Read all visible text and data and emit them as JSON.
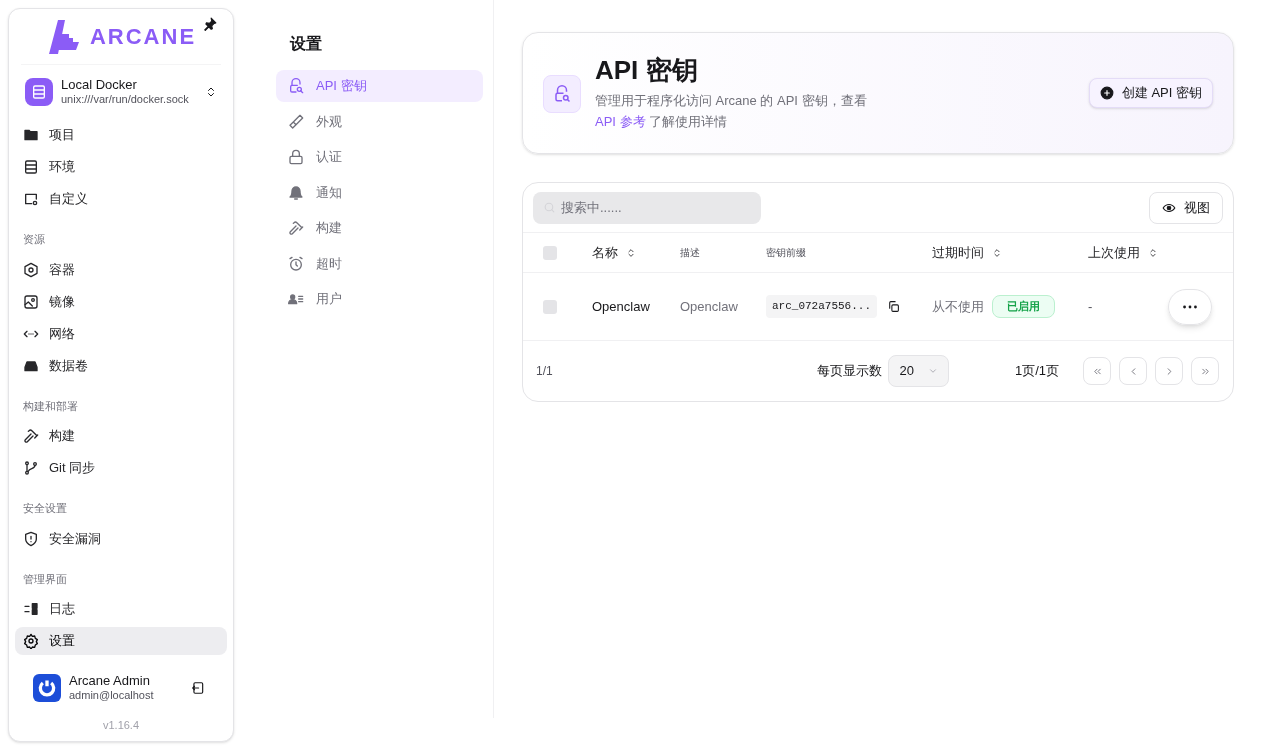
{
  "sidebar": {
    "logo": "ARCANE",
    "environment": {
      "name": "Local Docker",
      "address": "unix:///var/run/docker.sock"
    },
    "sections": [
      {
        "items": [
          {
            "label": "项目",
            "selected": false
          },
          {
            "label": "环境",
            "selected": false
          },
          {
            "label": "自定义",
            "selected": false
          }
        ]
      },
      {
        "heading": "资源",
        "items": [
          {
            "label": "容器",
            "selected": false
          },
          {
            "label": "镜像",
            "selected": false
          },
          {
            "label": "网络",
            "selected": false
          },
          {
            "label": "数据卷",
            "selected": false
          }
        ]
      },
      {
        "heading": "构建和部署",
        "items": [
          {
            "label": "构建",
            "selected": false
          },
          {
            "label": "Git 同步",
            "selected": false
          }
        ]
      },
      {
        "heading": "安全设置",
        "items": [
          {
            "label": "安全漏洞",
            "selected": false
          }
        ]
      },
      {
        "heading": "管理界面",
        "items": [
          {
            "label": "日志",
            "selected": false
          },
          {
            "label": "设置",
            "selected": true
          }
        ]
      }
    ],
    "user": {
      "name": "Arcane Admin",
      "email": "admin@localhost"
    },
    "version": "v1.16.4"
  },
  "settings_nav": {
    "title": "设置",
    "items": [
      {
        "label": "API 密钥",
        "selected": true
      },
      {
        "label": "外观",
        "selected": false
      },
      {
        "label": "认证",
        "selected": false
      },
      {
        "label": "通知",
        "selected": false
      },
      {
        "label": "构建",
        "selected": false
      },
      {
        "label": "超时",
        "selected": false
      },
      {
        "label": "用户",
        "selected": false
      }
    ]
  },
  "header": {
    "title": "API 密钥",
    "description": [
      "管理用于程序化访问 Arcane 的 API 密钥，查看 ",
      "API 参考",
      " 了解使用详情"
    ],
    "button": "创建 API 密钥"
  },
  "table": {
    "select_all_checked": false,
    "search_placeholder": "搜索中......",
    "view_button": "视图",
    "columns": [
      {
        "label": "名称",
        "sortable": true
      },
      {
        "label": "描述",
        "sortable": false
      },
      {
        "label": "密钥前缀",
        "sortable": false
      },
      {
        "label": "过期时间",
        "sortable": true
      },
      {
        "label": "上次使用",
        "sortable": true
      }
    ],
    "rows": [
      {
        "checked": false,
        "name": "Openclaw",
        "description": "Openclaw",
        "prefix": "arc_072a7556...",
        "expires": "从不使用",
        "status": "已启用",
        "last_used": "-"
      }
    ],
    "row_count": "1/1",
    "page_size_label": "每页显示数",
    "page_size": "20",
    "page_info": "1页/1页"
  }
}
